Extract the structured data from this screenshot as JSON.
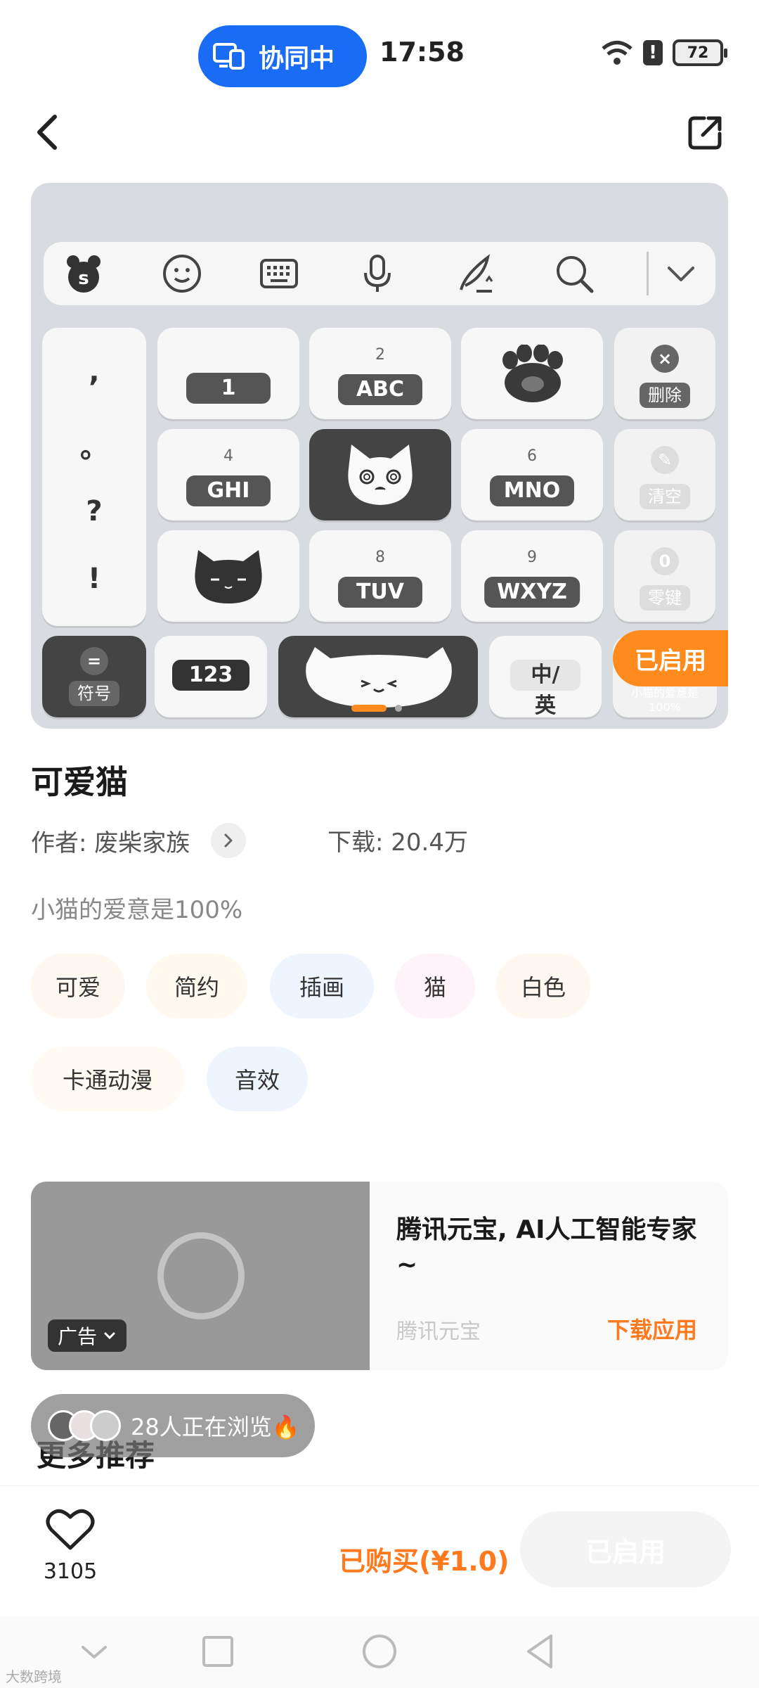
{
  "status_bar": {
    "collab_label": "协同中",
    "time": "17:58",
    "battery": "72"
  },
  "keyboard_preview": {
    "keys": {
      "k1": "1",
      "k2_num": "2",
      "k2": "ABC",
      "k4_num": "4",
      "k4": "GHI",
      "k6_num": "6",
      "k6": "MNO",
      "k8_num": "8",
      "k8": "TUV",
      "k9_num": "9",
      "k9": "WXYZ",
      "delete": "删除",
      "clear": "清空",
      "zero": "零键",
      "symbol": "符号",
      "num_switch": "123",
      "lang": "中/英"
    },
    "punctuation": [
      ",",
      "。",
      "?",
      "!"
    ],
    "corner_caption": "小猫的爱意是100%",
    "enabled_badge": "已启用"
  },
  "theme": {
    "title": "可爱猫",
    "author": "作者: 废柴家族",
    "downloads": "下载: 20.4万",
    "description": "小猫的爱意是100%",
    "tags": [
      "可爱",
      "简约",
      "插画",
      "猫",
      "白色",
      "卡通动漫",
      "音效"
    ]
  },
  "ad": {
    "label": "广告",
    "title": "腾讯元宝, AI人工智能专家~",
    "source": "腾讯元宝",
    "cta": "下载应用"
  },
  "browsing": "28人正在浏览🔥",
  "more_section": "更多推荐",
  "action_bar": {
    "like_count": "3105",
    "purchased": "已购买(¥1.0)",
    "enabled_button": "已启用"
  },
  "watermark": "大数跨境",
  "colors": {
    "accent_orange": "#ff8a1e",
    "collab_blue": "#1a6cf5"
  }
}
